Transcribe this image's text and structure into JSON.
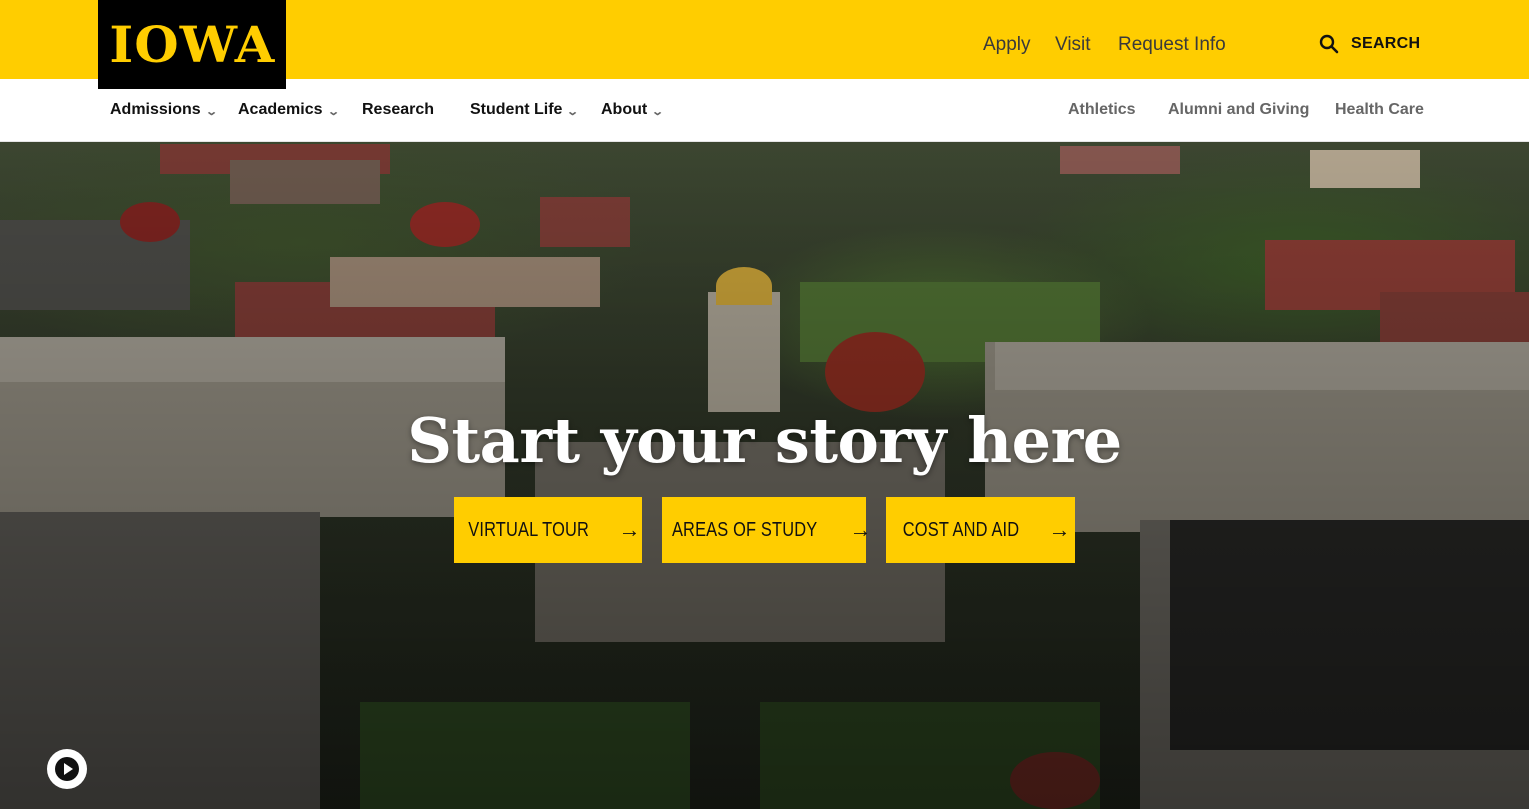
{
  "brand": {
    "logo_text": "IOWA"
  },
  "utility_nav": [
    {
      "label": "Apply"
    },
    {
      "label": "Visit"
    },
    {
      "label": "Request Info"
    }
  ],
  "search": {
    "label": "SEARCH",
    "icon": "search-icon"
  },
  "main_nav": {
    "left": [
      {
        "label": "Admissions",
        "has_dropdown": true
      },
      {
        "label": "Academics",
        "has_dropdown": true
      },
      {
        "label": "Research",
        "has_dropdown": false
      },
      {
        "label": "Student Life",
        "has_dropdown": true
      },
      {
        "label": "About",
        "has_dropdown": true
      }
    ],
    "right": [
      {
        "label": "Athletics"
      },
      {
        "label": "Alumni and Giving"
      },
      {
        "label": "Health Care"
      }
    ]
  },
  "hero": {
    "headline": "Start your story here",
    "ctas": [
      {
        "label": "VIRTUAL TOUR"
      },
      {
        "label": "AREAS OF STUDY"
      },
      {
        "label": "COST AND AID"
      }
    ],
    "video_control": "play-icon"
  },
  "colors": {
    "brand_gold": "#ffcd00",
    "brand_black": "#000000",
    "nav_text": "#111111",
    "secondary_nav_text": "#666666"
  }
}
